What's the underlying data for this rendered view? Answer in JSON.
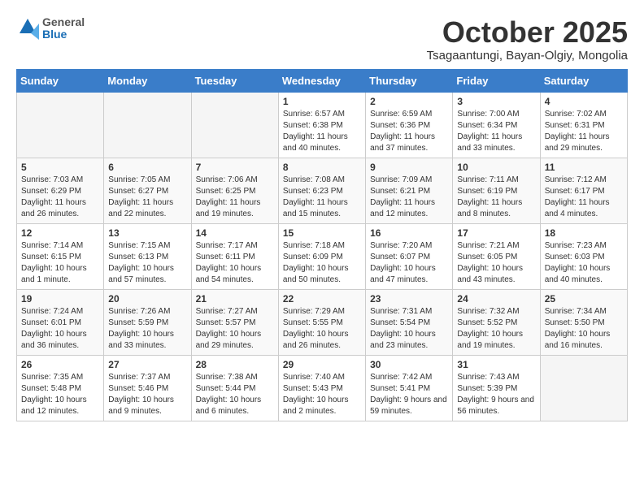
{
  "header": {
    "logo_general": "General",
    "logo_blue": "Blue",
    "month_title": "October 2025",
    "location": "Tsagaantungi, Bayan-Olgiy, Mongolia"
  },
  "weekdays": [
    "Sunday",
    "Monday",
    "Tuesday",
    "Wednesday",
    "Thursday",
    "Friday",
    "Saturday"
  ],
  "weeks": [
    [
      {
        "day": "",
        "empty": true
      },
      {
        "day": "",
        "empty": true
      },
      {
        "day": "",
        "empty": true
      },
      {
        "day": "1",
        "sunrise": "6:57 AM",
        "sunset": "6:38 PM",
        "daylight": "11 hours and 40 minutes."
      },
      {
        "day": "2",
        "sunrise": "6:59 AM",
        "sunset": "6:36 PM",
        "daylight": "11 hours and 37 minutes."
      },
      {
        "day": "3",
        "sunrise": "7:00 AM",
        "sunset": "6:34 PM",
        "daylight": "11 hours and 33 minutes."
      },
      {
        "day": "4",
        "sunrise": "7:02 AM",
        "sunset": "6:31 PM",
        "daylight": "11 hours and 29 minutes."
      }
    ],
    [
      {
        "day": "5",
        "sunrise": "7:03 AM",
        "sunset": "6:29 PM",
        "daylight": "11 hours and 26 minutes."
      },
      {
        "day": "6",
        "sunrise": "7:05 AM",
        "sunset": "6:27 PM",
        "daylight": "11 hours and 22 minutes."
      },
      {
        "day": "7",
        "sunrise": "7:06 AM",
        "sunset": "6:25 PM",
        "daylight": "11 hours and 19 minutes."
      },
      {
        "day": "8",
        "sunrise": "7:08 AM",
        "sunset": "6:23 PM",
        "daylight": "11 hours and 15 minutes."
      },
      {
        "day": "9",
        "sunrise": "7:09 AM",
        "sunset": "6:21 PM",
        "daylight": "11 hours and 12 minutes."
      },
      {
        "day": "10",
        "sunrise": "7:11 AM",
        "sunset": "6:19 PM",
        "daylight": "11 hours and 8 minutes."
      },
      {
        "day": "11",
        "sunrise": "7:12 AM",
        "sunset": "6:17 PM",
        "daylight": "11 hours and 4 minutes."
      }
    ],
    [
      {
        "day": "12",
        "sunrise": "7:14 AM",
        "sunset": "6:15 PM",
        "daylight": "10 hours and 1 minute."
      },
      {
        "day": "13",
        "sunrise": "7:15 AM",
        "sunset": "6:13 PM",
        "daylight": "10 hours and 57 minutes."
      },
      {
        "day": "14",
        "sunrise": "7:17 AM",
        "sunset": "6:11 PM",
        "daylight": "10 hours and 54 minutes."
      },
      {
        "day": "15",
        "sunrise": "7:18 AM",
        "sunset": "6:09 PM",
        "daylight": "10 hours and 50 minutes."
      },
      {
        "day": "16",
        "sunrise": "7:20 AM",
        "sunset": "6:07 PM",
        "daylight": "10 hours and 47 minutes."
      },
      {
        "day": "17",
        "sunrise": "7:21 AM",
        "sunset": "6:05 PM",
        "daylight": "10 hours and 43 minutes."
      },
      {
        "day": "18",
        "sunrise": "7:23 AM",
        "sunset": "6:03 PM",
        "daylight": "10 hours and 40 minutes."
      }
    ],
    [
      {
        "day": "19",
        "sunrise": "7:24 AM",
        "sunset": "6:01 PM",
        "daylight": "10 hours and 36 minutes."
      },
      {
        "day": "20",
        "sunrise": "7:26 AM",
        "sunset": "5:59 PM",
        "daylight": "10 hours and 33 minutes."
      },
      {
        "day": "21",
        "sunrise": "7:27 AM",
        "sunset": "5:57 PM",
        "daylight": "10 hours and 29 minutes."
      },
      {
        "day": "22",
        "sunrise": "7:29 AM",
        "sunset": "5:55 PM",
        "daylight": "10 hours and 26 minutes."
      },
      {
        "day": "23",
        "sunrise": "7:31 AM",
        "sunset": "5:54 PM",
        "daylight": "10 hours and 23 minutes."
      },
      {
        "day": "24",
        "sunrise": "7:32 AM",
        "sunset": "5:52 PM",
        "daylight": "10 hours and 19 minutes."
      },
      {
        "day": "25",
        "sunrise": "7:34 AM",
        "sunset": "5:50 PM",
        "daylight": "10 hours and 16 minutes."
      }
    ],
    [
      {
        "day": "26",
        "sunrise": "7:35 AM",
        "sunset": "5:48 PM",
        "daylight": "10 hours and 12 minutes."
      },
      {
        "day": "27",
        "sunrise": "7:37 AM",
        "sunset": "5:46 PM",
        "daylight": "10 hours and 9 minutes."
      },
      {
        "day": "28",
        "sunrise": "7:38 AM",
        "sunset": "5:44 PM",
        "daylight": "10 hours and 6 minutes."
      },
      {
        "day": "29",
        "sunrise": "7:40 AM",
        "sunset": "5:43 PM",
        "daylight": "10 hours and 2 minutes."
      },
      {
        "day": "30",
        "sunrise": "7:42 AM",
        "sunset": "5:41 PM",
        "daylight": "9 hours and 59 minutes."
      },
      {
        "day": "31",
        "sunrise": "7:43 AM",
        "sunset": "5:39 PM",
        "daylight": "9 hours and 56 minutes."
      },
      {
        "day": "",
        "empty": true
      }
    ]
  ]
}
